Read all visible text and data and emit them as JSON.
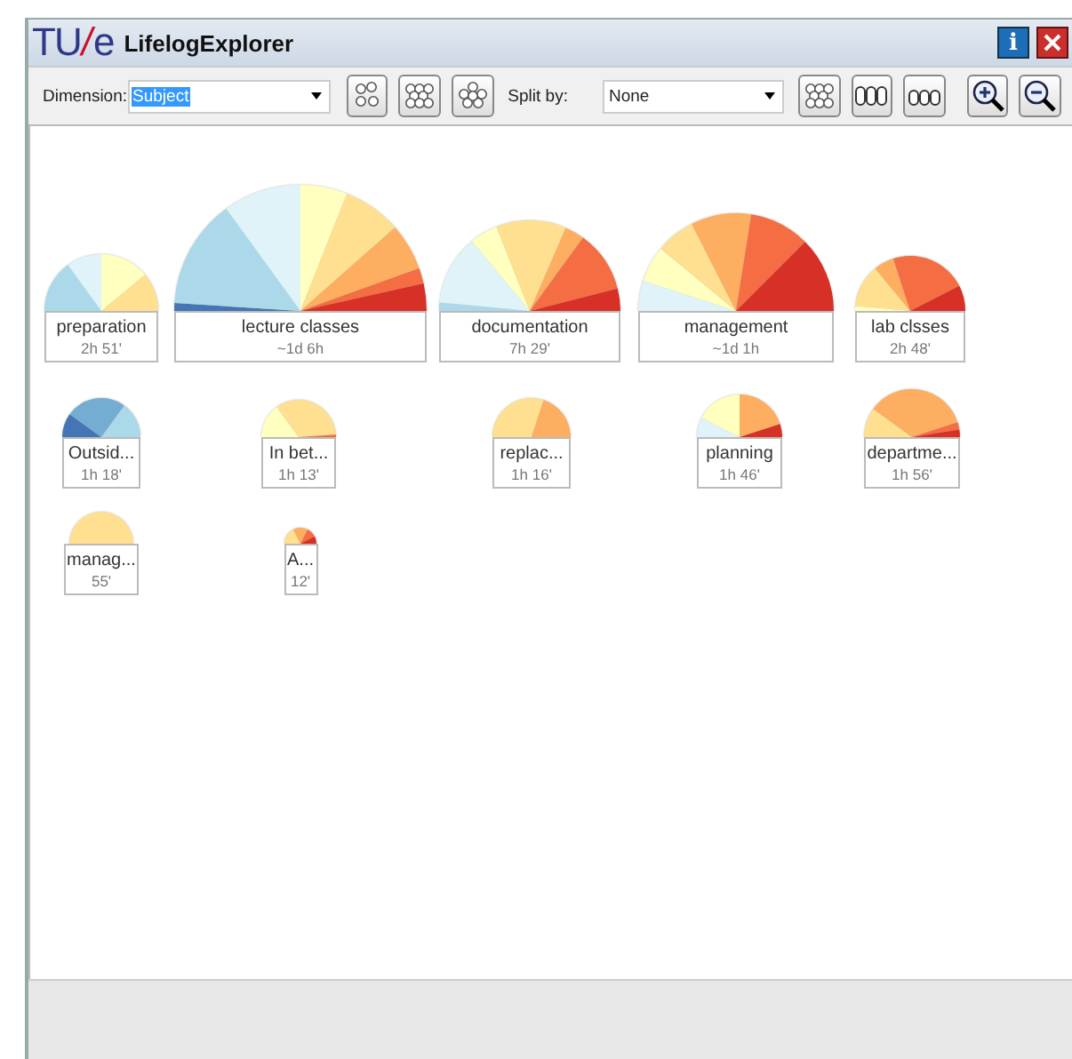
{
  "window": {
    "logo": {
      "left": "TU",
      "slash": "/",
      "right": "e"
    },
    "title": "LifelogExplorer",
    "info_button": "i"
  },
  "toolbar": {
    "dimension_label": "Dimension:",
    "dimension_value": "Subject",
    "split_label": "Split by:",
    "split_value": "None"
  },
  "glyphs": [
    {
      "label": "preparation",
      "duration": "2h 51'"
    },
    {
      "label": "lecture classes",
      "duration": "~1d 6h"
    },
    {
      "label": "documentation",
      "duration": "7h 29'"
    },
    {
      "label": "management",
      "duration": "~1d 1h"
    },
    {
      "label": "lab clsses",
      "duration": "2h 48'"
    },
    {
      "label": "Outsid...",
      "duration": "1h 18'"
    },
    {
      "label": "In bet...",
      "duration": "1h 13'"
    },
    {
      "label": "replac...",
      "duration": "1h 16'"
    },
    {
      "label": "planning",
      "duration": "1h 46'"
    },
    {
      "label": "departme...",
      "duration": "1h 56'"
    },
    {
      "label": "manag...",
      "duration": "55'"
    },
    {
      "label": "A...",
      "duration": "12'"
    }
  ]
}
